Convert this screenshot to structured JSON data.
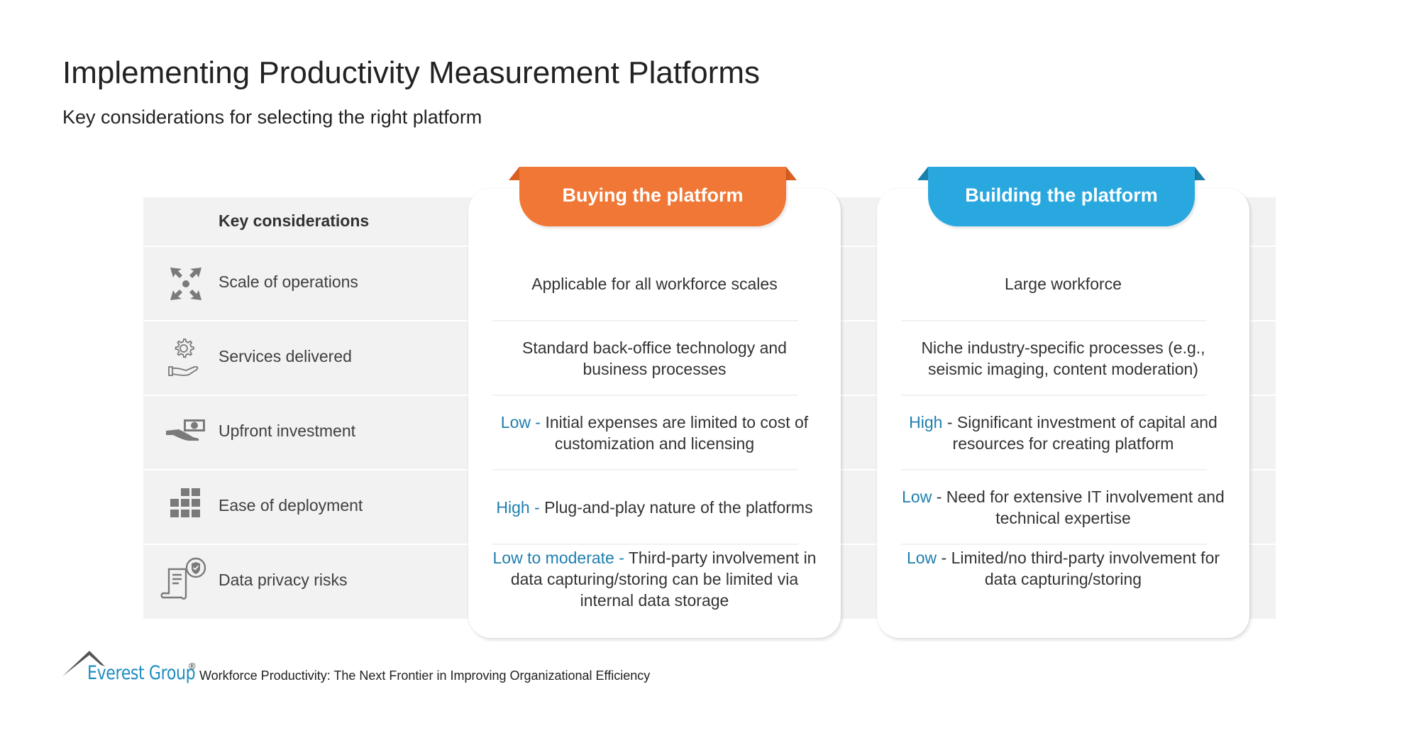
{
  "header": {
    "title": "Implementing Productivity Measurement Platforms",
    "subtitle": "Key considerations for selecting the right platform"
  },
  "table": {
    "key_header": "Key considerations",
    "options": [
      {
        "label": "Buying the platform",
        "color": "#F07735",
        "flap_color": "#D95F22"
      },
      {
        "label": "Building the platform",
        "color": "#29A8E0",
        "flap_color": "#1B80AB"
      }
    ],
    "level_color": "#1F7FAE",
    "rows": [
      {
        "key": "Scale of operations",
        "icon": "expand-arrows-icon",
        "buy": {
          "level": "",
          "sep": "",
          "text": "Applicable for all workforce scales"
        },
        "build": {
          "level": "",
          "sep": "",
          "text": "Large workforce"
        }
      },
      {
        "key": "Services delivered",
        "icon": "gear-hand-icon",
        "buy": {
          "level": "",
          "sep": "",
          "text": "Standard back-office technology and business processes"
        },
        "build": {
          "level": "",
          "sep": "",
          "text": "Niche industry-specific processes (e.g., seismic imaging, content moderation)"
        }
      },
      {
        "key": "Upfront investment",
        "icon": "money-hand-icon",
        "buy": {
          "level": "Low -",
          "sep": " ",
          "text": "Initial expenses are limited to cost of customization and licensing"
        },
        "build": {
          "level": "High",
          "sep": " - ",
          "text": "Significant investment of capital and resources for creating platform"
        }
      },
      {
        "key": "Ease of deployment",
        "icon": "blocks-grid-icon",
        "buy": {
          "level": "High -",
          "sep": " ",
          "text": "Plug-and-play nature of the platforms"
        },
        "build": {
          "level": "Low",
          "sep": " - ",
          "text": "Need for extensive IT involvement and technical expertise"
        }
      },
      {
        "key": "Data privacy risks",
        "icon": "document-shield-icon",
        "buy": {
          "level": "Low to moderate -",
          "sep": " ",
          "text": "Third-party involvement in data capturing/storing can be limited via internal data storage"
        },
        "build": {
          "level": "Low",
          "sep": " - ",
          "text": "Limited/no third-party involvement for data capturing/storing"
        }
      }
    ]
  },
  "footer": {
    "brand": "Everest Group",
    "registered_mark": "®",
    "brand_color": "#1F8DC0",
    "source": "Workforce Productivity: The Next Frontier in Improving Organizational Efficiency"
  }
}
